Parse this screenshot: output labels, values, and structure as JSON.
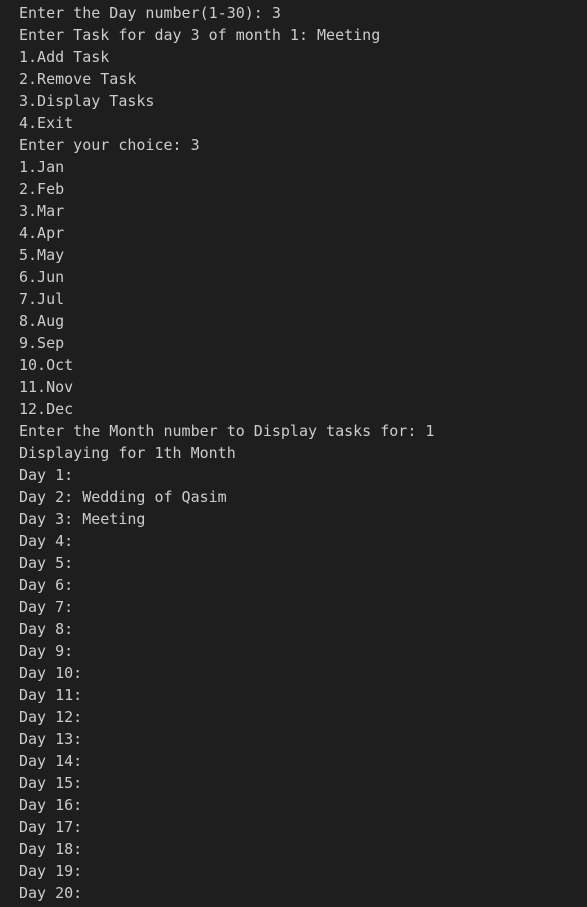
{
  "terminal": {
    "lines": [
      "Enter the Day number(1-30): 3",
      "Enter Task for day 3 of month 1: Meeting",
      "1.Add Task",
      "2.Remove Task",
      "3.Display Tasks",
      "4.Exit",
      "Enter your choice: 3",
      "1.Jan",
      "2.Feb",
      "3.Mar",
      "4.Apr",
      "5.May",
      "6.Jun",
      "7.Jul",
      "8.Aug",
      "9.Sep",
      "10.Oct",
      "11.Nov",
      "12.Dec",
      "Enter the Month number to Display tasks for: 1",
      "Displaying for 1th Month",
      "Day 1:",
      "Day 2: Wedding of Qasim",
      "Day 3: Meeting",
      "Day 4:",
      "Day 5:",
      "Day 6:",
      "Day 7:",
      "Day 8:",
      "Day 9:",
      "Day 10:",
      "Day 11:",
      "Day 12:",
      "Day 13:",
      "Day 14:",
      "Day 15:",
      "Day 16:",
      "Day 17:",
      "Day 18:",
      "Day 19:",
      "Day 20:"
    ]
  },
  "colors": {
    "background": "#1e1e1e",
    "text": "#cccccc"
  }
}
